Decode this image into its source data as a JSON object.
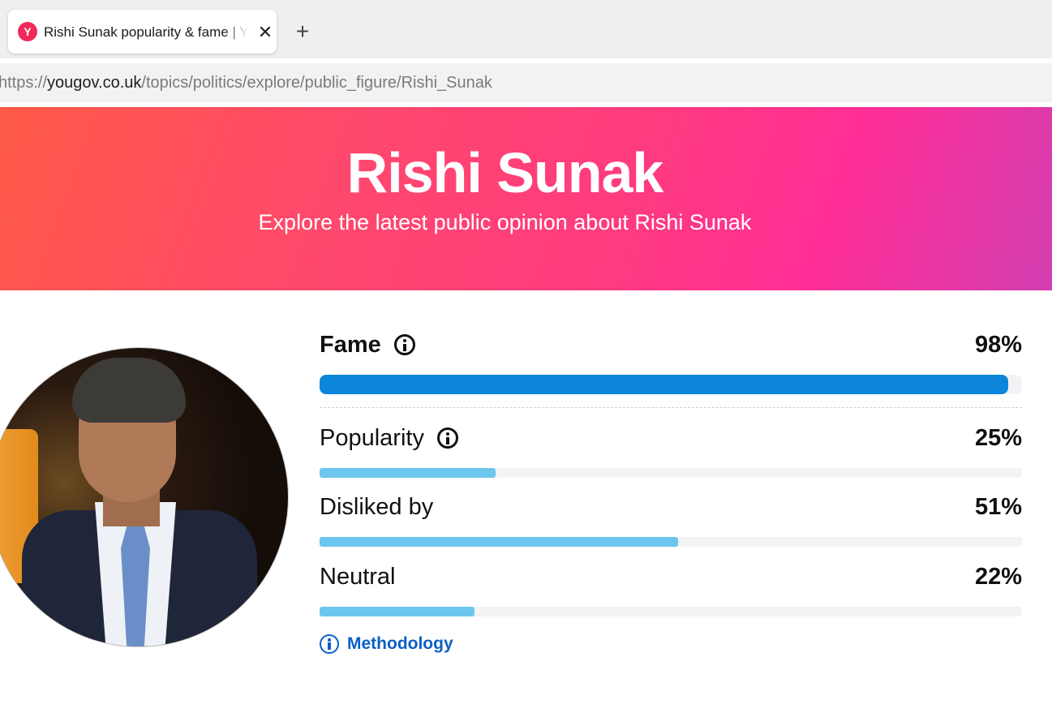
{
  "browser": {
    "tab_title": "Rishi Sunak popularity & fame | YouGov",
    "tab_favicon": "Y",
    "close_glyph": "✕",
    "new_tab_glyph": "+",
    "url_prefix": "https://",
    "url_domain": "yougov.co.uk",
    "url_path": "/topics/politics/explore/public_figure/Rishi_Sunak"
  },
  "hero": {
    "title": "Rishi Sunak",
    "subtitle": "Explore the latest public opinion about Rishi Sunak",
    "gradient_colors": [
      "#ff5a47",
      "#ff3a80",
      "#ff2e97",
      "#d23eb0"
    ]
  },
  "profile": {
    "photo": "portrait-photo"
  },
  "metrics": [
    {
      "key": "fame",
      "label": "Fame",
      "value": "98%",
      "percent": 98,
      "has_info": true,
      "color": "#0b86da"
    },
    {
      "key": "popularity",
      "label": "Popularity",
      "value": "25%",
      "percent": 25,
      "has_info": true,
      "color": "#6cc6ee"
    },
    {
      "key": "disliked",
      "label": "Disliked by",
      "value": "51%",
      "percent": 51,
      "has_info": false,
      "color": "#6cc6ee"
    },
    {
      "key": "neutral",
      "label": "Neutral",
      "value": "22%",
      "percent": 22,
      "has_info": false,
      "color": "#6cc6ee"
    }
  ],
  "methodology": {
    "label": "Methodology",
    "icon": "info-circle-icon",
    "color": "#0a5fc4"
  }
}
